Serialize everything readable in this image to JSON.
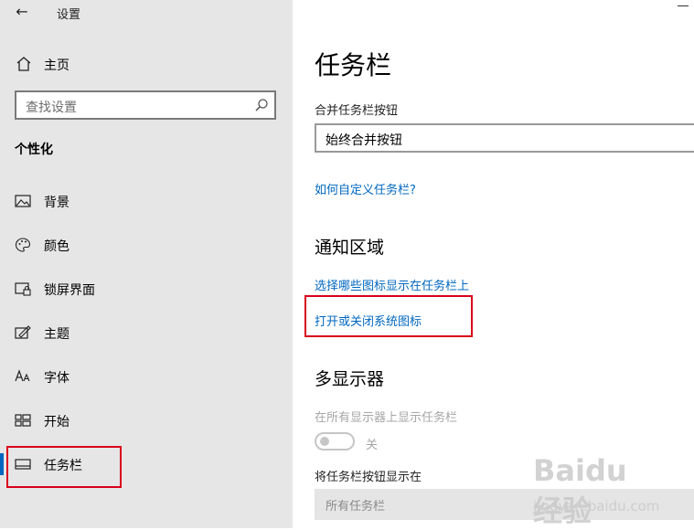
{
  "window": {
    "title": "设置",
    "back_glyph": "←"
  },
  "sidebar": {
    "home_label": "主页",
    "search_placeholder": "查找设置",
    "section": "个性化",
    "items": [
      {
        "label": "背景",
        "icon": "image-icon"
      },
      {
        "label": "颜色",
        "icon": "palette-icon"
      },
      {
        "label": "锁屏界面",
        "icon": "lock-screen-icon"
      },
      {
        "label": "主题",
        "icon": "theme-icon"
      },
      {
        "label": "字体",
        "icon": "font-icon"
      },
      {
        "label": "开始",
        "icon": "start-icon"
      },
      {
        "label": "任务栏",
        "icon": "taskbar-icon",
        "selected": true
      }
    ]
  },
  "main": {
    "title": "任务栏",
    "combine_label": "合并任务栏按钮",
    "combine_value": "始终合并按钮",
    "customize_link": "如何自定义任务栏?",
    "notification_heading": "通知区域",
    "link_select_icons": "选择哪些图标显示在任务栏上",
    "link_system_icons": "打开或关闭系统图标",
    "multi_heading": "多显示器",
    "show_on_all_label": "在所有显示器上显示任务栏",
    "toggle_state": "关",
    "show_buttons_label": "将任务栏按钮显示在",
    "show_buttons_value": "所有任务栏"
  },
  "watermark": {
    "line1": "Baidu 经验",
    "line2": "jingyan.baidu.com"
  },
  "colors": {
    "accent": "#0067c0",
    "highlight": "#d9001b",
    "sidebar_bg": "#e6e6e6"
  }
}
